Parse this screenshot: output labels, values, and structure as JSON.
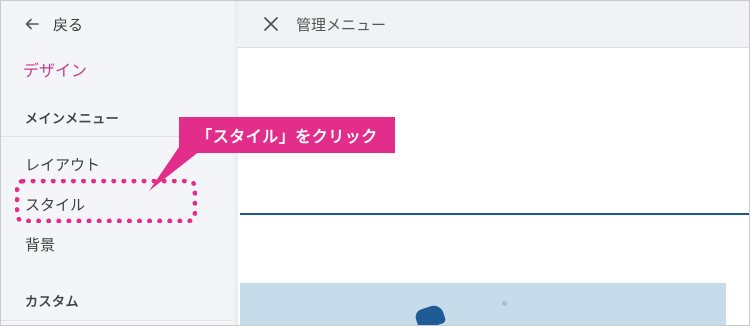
{
  "sidebar": {
    "back_label": "戻る",
    "panel_title": "デザイン",
    "section_main": "メインメニュー",
    "items": [
      {
        "label": "レイアウト"
      },
      {
        "label": "スタイル"
      },
      {
        "label": "背景"
      }
    ],
    "section_custom": "カスタム"
  },
  "topbar": {
    "title": "管理メニュー"
  },
  "annotation": {
    "callout_text": "「スタイル」をクリック",
    "color": "#e32d8a"
  },
  "theme": {
    "accent": "#c43d8e",
    "rule_color": "#1d5a8a"
  },
  "icons": {
    "back": "arrow-left-icon",
    "close": "close-icon"
  }
}
